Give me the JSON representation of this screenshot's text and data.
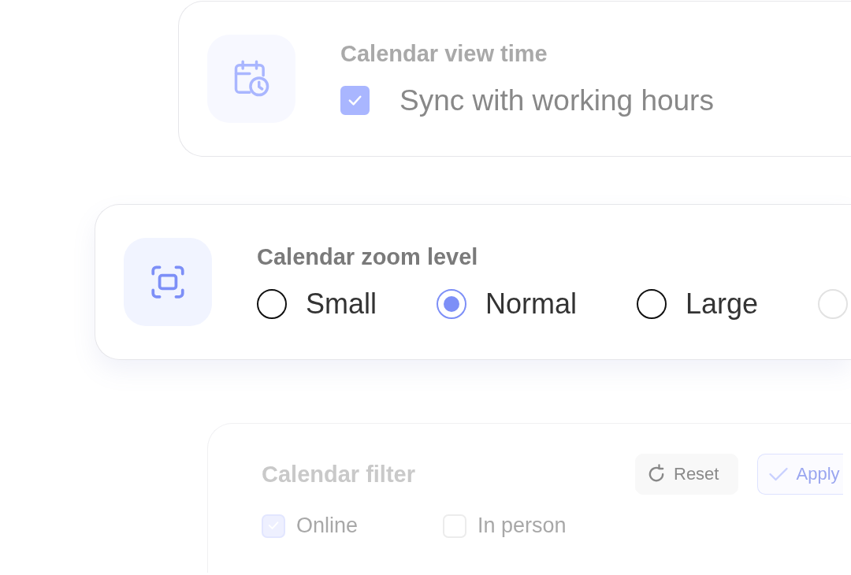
{
  "cards": [
    {
      "kind": "checkbox",
      "title": "Calendar view time",
      "options": [
        {
          "label": "Sync with working hours",
          "checked": true
        }
      ]
    },
    {
      "kind": "radio",
      "title": "Calendar zoom level",
      "options": [
        {
          "label": "Small",
          "selected": false
        },
        {
          "label": "Normal",
          "selected": true
        },
        {
          "label": "Large",
          "selected": false
        },
        {
          "selected": false
        }
      ]
    },
    {
      "kind": "filter",
      "title": "Calendar filter",
      "buttons": [
        {
          "kind": "reset",
          "label": "Reset"
        },
        {
          "kind": "apply",
          "label": "Apply"
        }
      ],
      "options": [
        {
          "label": "Online",
          "checked": true
        },
        {
          "label": "In person",
          "checked": false
        }
      ]
    }
  ]
}
